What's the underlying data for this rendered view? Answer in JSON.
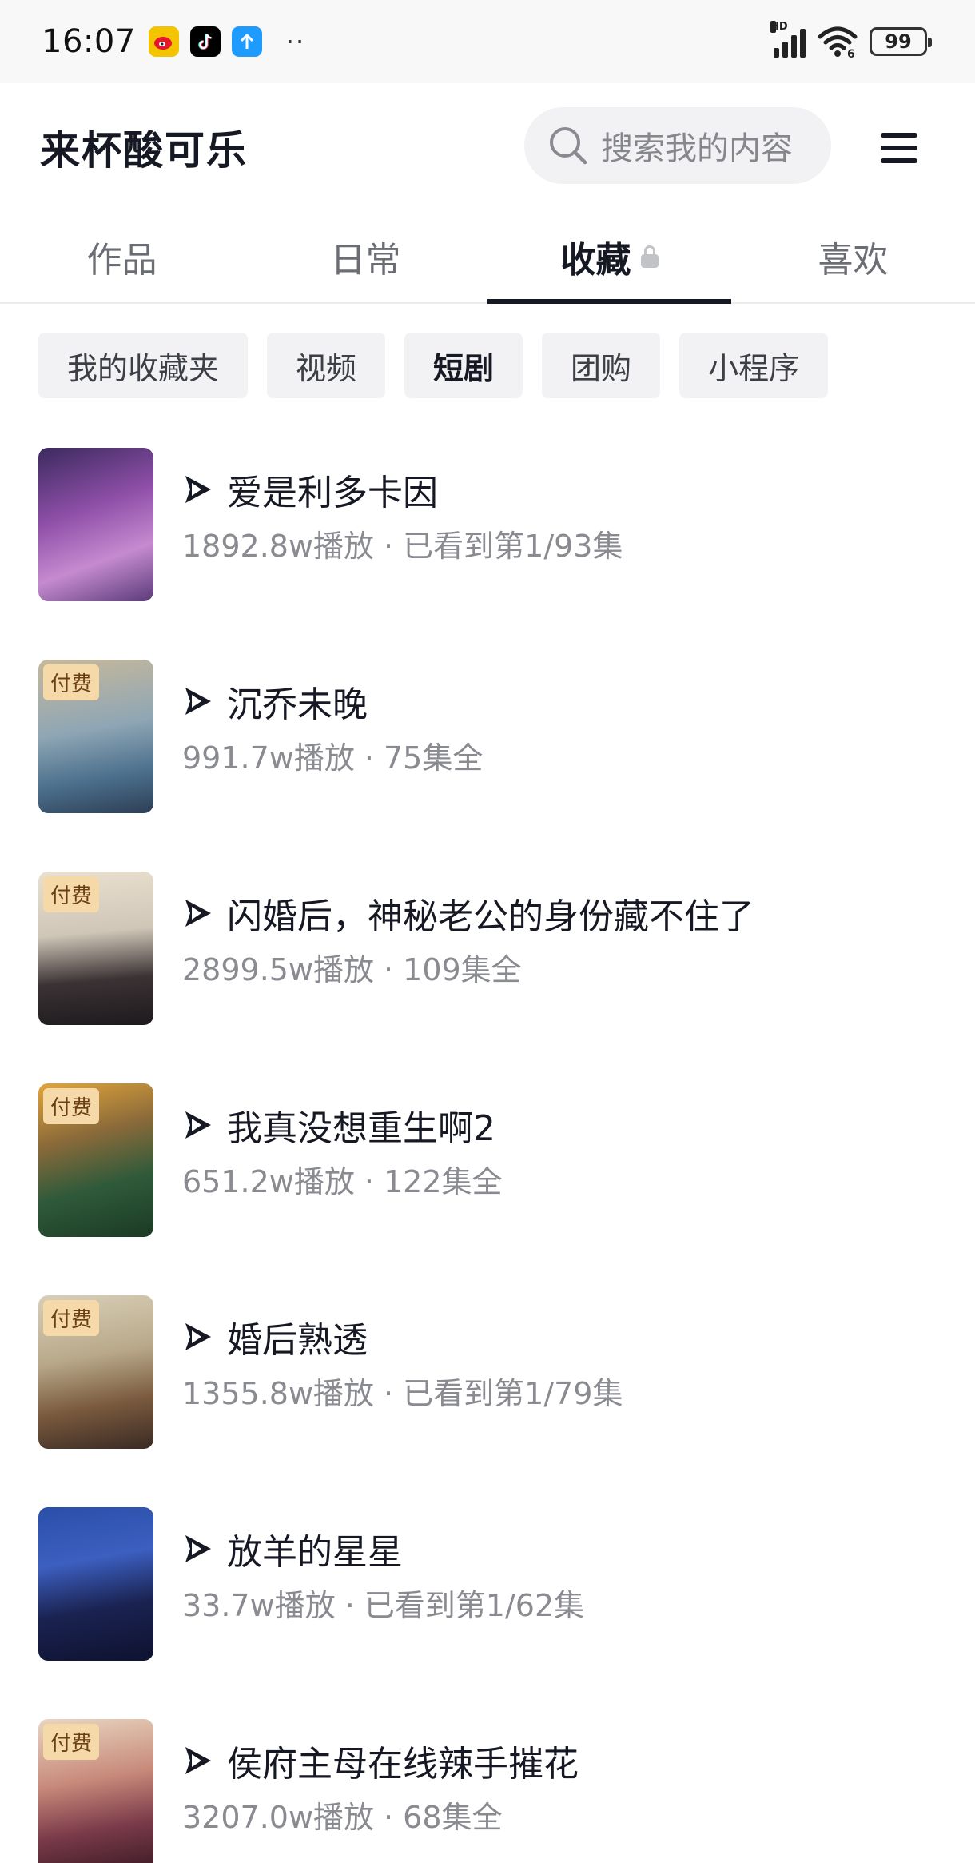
{
  "status_bar": {
    "time": "16:07",
    "signal_label": "HD",
    "battery": "99",
    "overflow": "··"
  },
  "header": {
    "profile_name": "来杯酸可乐",
    "search_placeholder": "搜索我的内容"
  },
  "tabs": [
    {
      "label": "作品",
      "active": false
    },
    {
      "label": "日常",
      "active": false
    },
    {
      "label": "收藏",
      "active": true,
      "locked": true
    },
    {
      "label": "喜欢",
      "active": false
    }
  ],
  "chips": [
    {
      "label": "我的收藏夹",
      "active": false
    },
    {
      "label": "视频",
      "active": false
    },
    {
      "label": "短剧",
      "active": true
    },
    {
      "label": "团购",
      "active": false
    },
    {
      "label": "小程序",
      "active": false
    }
  ],
  "items": [
    {
      "title": "爱是利多卡因",
      "plays": "1892.8w播放",
      "progress": "已看到第1/93集",
      "paid": false,
      "badge": ""
    },
    {
      "title": "沉乔未晚",
      "plays": "991.7w播放",
      "progress": "75集全",
      "paid": true,
      "badge": "付费"
    },
    {
      "title": "闪婚后，神秘老公的身份藏不住了",
      "plays": "2899.5w播放",
      "progress": "109集全",
      "paid": true,
      "badge": "付费"
    },
    {
      "title": "我真没想重生啊2",
      "plays": "651.2w播放",
      "progress": "122集全",
      "paid": true,
      "badge": "付费"
    },
    {
      "title": "婚后熟透",
      "plays": "1355.8w播放",
      "progress": "已看到第1/79集",
      "paid": true,
      "badge": "付费"
    },
    {
      "title": "放羊的星星",
      "plays": "33.7w播放",
      "progress": "已看到第1/62集",
      "paid": false,
      "badge": ""
    },
    {
      "title": "侯府主母在线辣手摧花",
      "plays": "3207.0w播放",
      "progress": "68集全",
      "paid": true,
      "badge": "付费"
    }
  ],
  "separator": "·",
  "colors": {
    "accent_text": "#161823",
    "secondary_text": "#8a8b91",
    "chip_bg": "#f2f2f4",
    "paid_badge_bg": "#f6d9a8"
  }
}
